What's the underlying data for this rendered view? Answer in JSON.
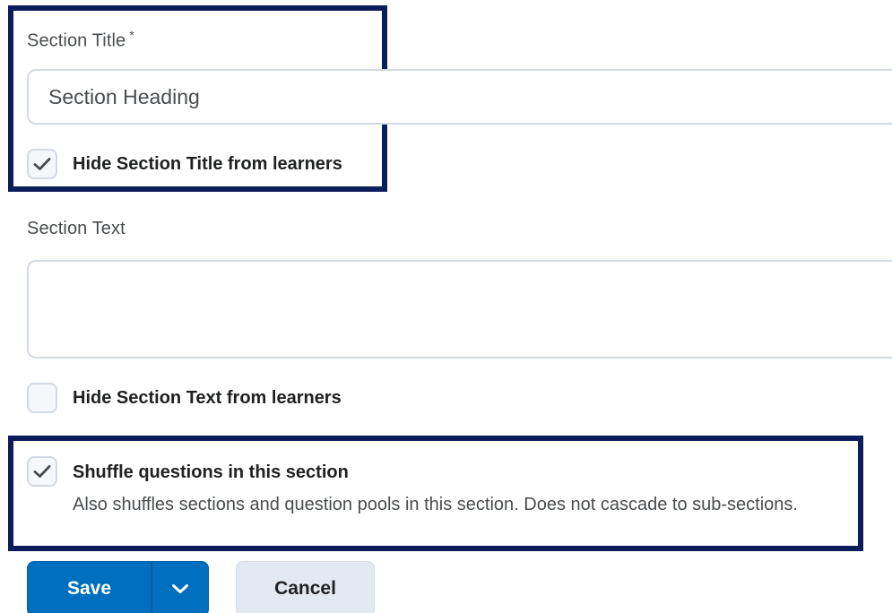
{
  "section_title": {
    "label": "Section Title",
    "required_marker": "*",
    "value": "Section Heading"
  },
  "hide_title": {
    "label": "Hide Section Title from learners",
    "checked": true
  },
  "section_text": {
    "label": "Section Text",
    "value": ""
  },
  "hide_text": {
    "label": "Hide Section Text from learners",
    "checked": false
  },
  "shuffle": {
    "label": "Shuffle questions in this section",
    "description": "Also shuffles sections and question pools in this section. Does not cascade to sub-sections.",
    "checked": true
  },
  "buttons": {
    "save_label": "Save",
    "cancel_label": "Cancel"
  },
  "colors": {
    "highlight_border": "#0b1e5b",
    "primary": "#006fbf",
    "secondary": "#e3e9f1"
  },
  "icons": {
    "checkmark": "check-icon",
    "dropdown": "chevron-down-icon"
  }
}
